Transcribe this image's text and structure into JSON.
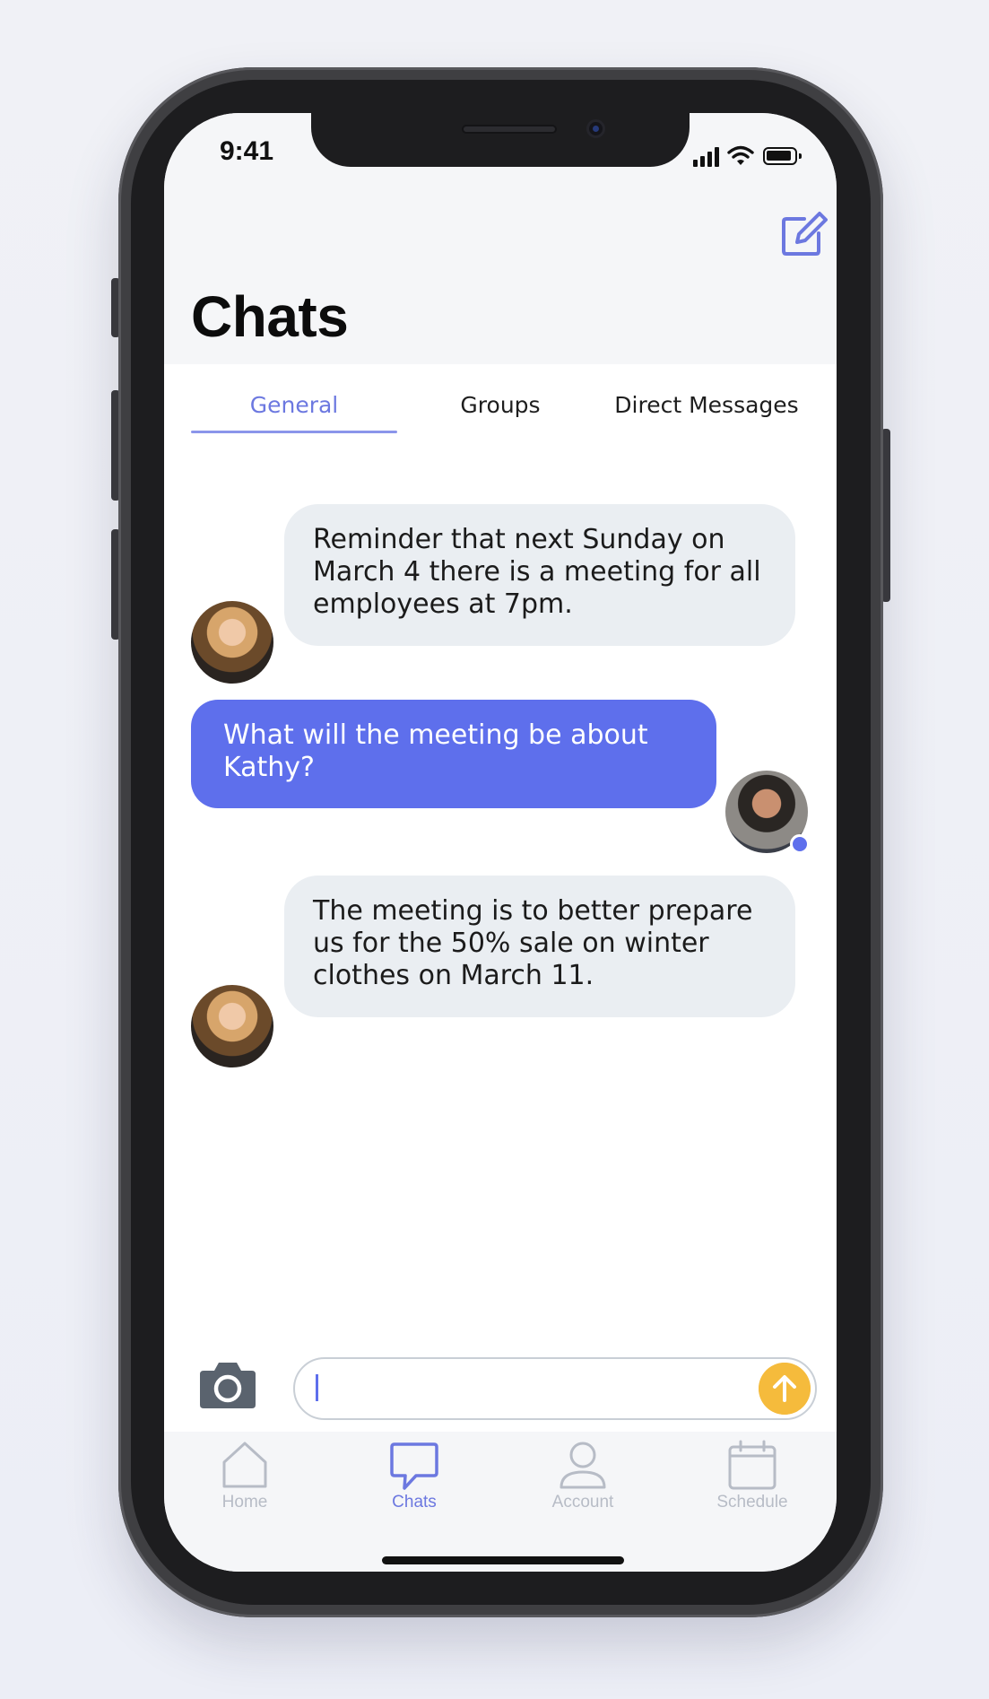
{
  "status_bar": {
    "time": "9:41"
  },
  "header": {
    "title": "Chats"
  },
  "tabs": [
    {
      "label": "General",
      "active": true
    },
    {
      "label": "Groups",
      "active": false
    },
    {
      "label": "Direct Messages",
      "active": false
    }
  ],
  "messages": [
    {
      "direction": "incoming",
      "text": "Reminder that next Sunday on March 4 there is a meeting for all employees at 7pm."
    },
    {
      "direction": "outgoing",
      "text": "What will the meeting be about Kathy?"
    },
    {
      "direction": "incoming",
      "text": "The meeting is to better prepare us for the 50% sale on winter clothes on March 11."
    }
  ],
  "composer": {
    "value": "",
    "placeholder": ""
  },
  "nav": [
    {
      "label": "Home",
      "icon": "home-icon",
      "active": false
    },
    {
      "label": "Chats",
      "icon": "chat-bubble-icon",
      "active": true
    },
    {
      "label": "Account",
      "icon": "person-icon",
      "active": false
    },
    {
      "label": "Schedule",
      "icon": "calendar-icon",
      "active": false
    }
  ],
  "colors": {
    "accent": "#5e6fec",
    "incoming_bubble": "#eaeef2",
    "send_button": "#f5bb3c",
    "inactive_nav": "#b7bcc6"
  }
}
